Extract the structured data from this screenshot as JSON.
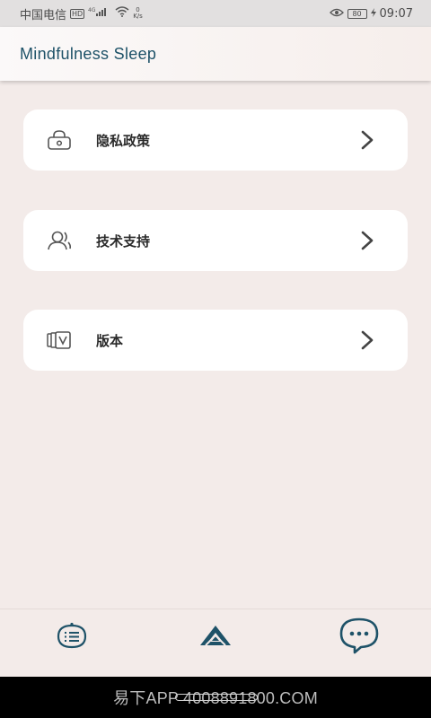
{
  "status_bar": {
    "carrier": "中国电信",
    "hd_badge": "HD",
    "network": "4G",
    "speed_value": "0",
    "speed_unit": "K/s",
    "battery": "80",
    "time": "09:07"
  },
  "header": {
    "title": "Mindfulness Sleep"
  },
  "menu": {
    "items": [
      {
        "label": "隐私政策",
        "icon": "lock-icon"
      },
      {
        "label": "技术支持",
        "icon": "support-people-icon"
      },
      {
        "label": "版本",
        "icon": "version-cards-icon"
      }
    ]
  },
  "bottom_nav": {
    "items": [
      {
        "icon": "list-icon"
      },
      {
        "icon": "mountain-logo-icon"
      },
      {
        "icon": "chat-bubble-icon"
      }
    ]
  },
  "watermark": {
    "text": "易下APP 4008891800.COM"
  },
  "colors": {
    "accent": "#1e5268",
    "background": "#f3ebe9",
    "card": "#ffffff"
  }
}
